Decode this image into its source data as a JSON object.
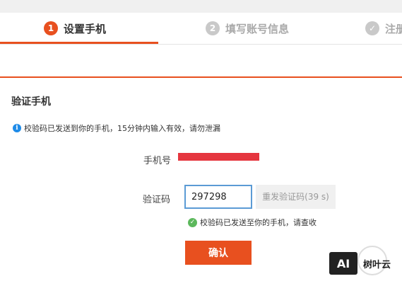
{
  "steps": [
    {
      "num": "1",
      "label": "设置手机"
    },
    {
      "num": "2",
      "label": "填写账号信息"
    },
    {
      "num": "✓",
      "label": "注册"
    }
  ],
  "section": {
    "title": "验证手机"
  },
  "notice": {
    "icon": "info-icon",
    "text": "校验码已发送到你的手机，15分钟内输入有效，请勿泄漏"
  },
  "form": {
    "phone_label": "手机号",
    "code_label": "验证码",
    "code_value": "297298",
    "resend_label": "重发验证码(39 s)",
    "sent_msg": "校验码已发送至你的手机，请查收",
    "confirm_label": "确认"
  },
  "watermark": {
    "logo": "AI",
    "text": "树叶云"
  },
  "colors": {
    "accent": "#e8501f",
    "info": "#1e8be8",
    "success": "#5cb85c",
    "redact": "#e5363f"
  }
}
